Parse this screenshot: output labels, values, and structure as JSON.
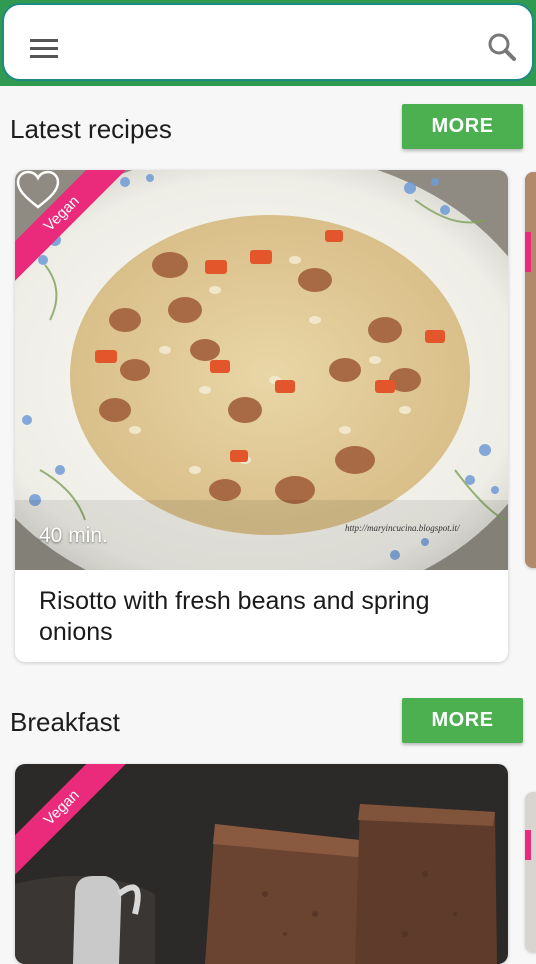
{
  "search": {
    "placeholder": ""
  },
  "icons": {
    "menu": "hamburger-menu-icon",
    "search": "search-icon",
    "favorite": "heart-outline-icon"
  },
  "colors": {
    "primary": "#2f9a50",
    "button": "#4caf50",
    "ribbon": "#ea2a7a"
  },
  "sections": [
    {
      "title": "Latest recipes",
      "more_label": "MORE",
      "card": {
        "badge": "Vegan",
        "time": "40 min.",
        "title": "Risotto with fresh beans and spring onions",
        "watermark": "http://maryincucina.blogspot.it/"
      }
    },
    {
      "title": "Breakfast",
      "more_label": "MORE",
      "card": {
        "badge": "Vegan"
      }
    }
  ]
}
